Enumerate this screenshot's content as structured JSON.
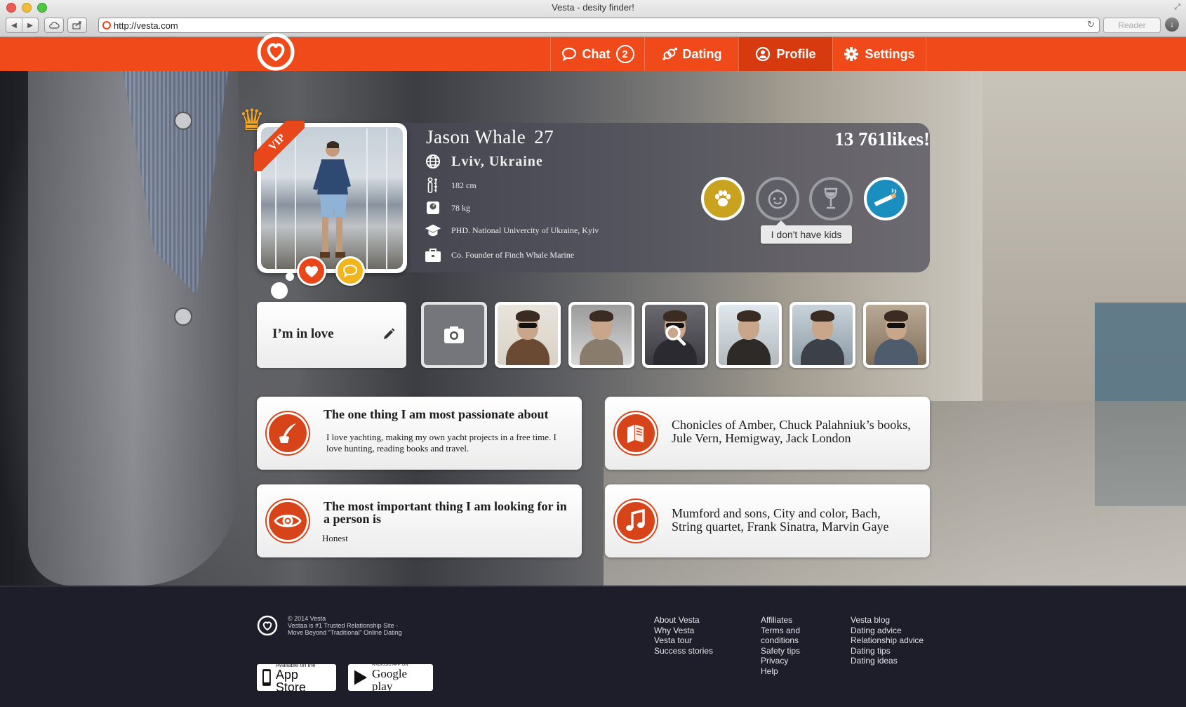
{
  "browser": {
    "window_title": "Vesta - desity finder!",
    "url": "http://vesta.com",
    "reader_label": "Reader"
  },
  "nav": {
    "chat_label": "Chat",
    "chat_count": "2",
    "dating_label": "Dating",
    "profile_label": "Profile",
    "settings_label": "Settings"
  },
  "profile": {
    "name": "Jason Whale",
    "age": "27",
    "location": "Lviv, Ukraine",
    "height": "182 cm",
    "weight": "78 kg",
    "education": "PHD. National Univercity of Ukraine, Kyiv",
    "job": "Co. Founder of Finch Whale Marine",
    "likes": "13 761likes!",
    "badge": "VIP",
    "kids_tooltip": "I don't have kids",
    "status": "I’m in love"
  },
  "cards": {
    "passion_title": "The one thing I am most passionate about",
    "passion_text": "I love yachting, making my own yacht projects in a free time. I love hunting, reading books and travel.",
    "books_text": "Chonicles of Amber, Chuck Palahniuk’s books, Jule Vern, Hemigway, Jack London",
    "looking_title": "The most important thing I am looking for in a person is",
    "looking_text": "Honest",
    "music_text": "Mumford and sons, City and color, Bach, String quartet, Frank Sinatra, Marvin Gaye"
  },
  "footer": {
    "copyright_line1": "© 2014 Vesta",
    "copyright_line2": "Vestaa is #1 Trusted Relationship Site -",
    "copyright_line3": "Move Beyond \"Traditional\" Online Dating",
    "col1": [
      "About Vesta",
      "Why Vesta",
      "Vesta tour",
      "Success stories"
    ],
    "col2": [
      "Affiliates",
      "Terms and",
      "conditions",
      "Safety tips",
      "Privacy",
      "Help"
    ],
    "col3": [
      "Vesta blog",
      "Dating advice",
      "Relationship advice",
      "Dating tips",
      "Dating ideas"
    ],
    "appstore_small": "Available on the",
    "appstore_large": "App Store",
    "googleplay_small": "ANDROID APP ON",
    "googleplay_large": "Google play"
  },
  "colors": {
    "brand_orange": "#f14a1a",
    "active_tab": "#d73a0e",
    "footer_bg": "#1e1e2a"
  }
}
